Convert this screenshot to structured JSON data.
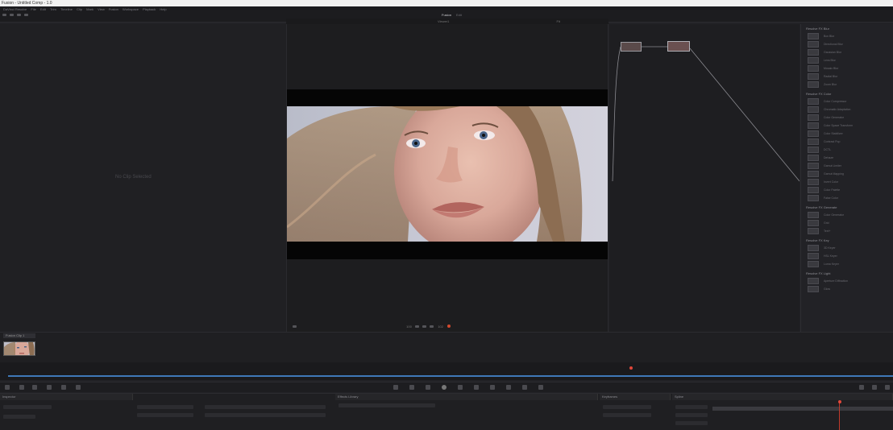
{
  "window": {
    "title": "Fusion - Untitled Comp - 1.0"
  },
  "menu": [
    "DaVinci Resolve",
    "File",
    "Edit",
    "Trim",
    "Timeline",
    "Clip",
    "Mark",
    "View",
    "Fusion",
    "Workspace",
    "Playback",
    "Help"
  ],
  "tabs": {
    "left": "Fusion",
    "center": "Edit"
  },
  "viewer": {
    "header_label": "Viewer1",
    "empty_left_text": "No Clip Selected",
    "zoom": "Fit",
    "timecode": "100",
    "frame": "102"
  },
  "clip": {
    "label": "Fusion Clip 1"
  },
  "effects": {
    "sections": [
      {
        "title": "Resolve FX Blur",
        "items": [
          "Box Blur",
          "Directional Blur",
          "Gaussian Blur",
          "Lens Blur",
          "Mosaic Blur",
          "Radial Blur",
          "Zoom Blur"
        ]
      },
      {
        "title": "Resolve FX Color",
        "items": [
          "Color Compressor",
          "Chromatic Adaptation",
          "Color Generator",
          "Color Space Transform",
          "Color Stabilizer",
          "Contrast Pop",
          "DCTL",
          "Dehaze",
          "Gamut Limiter",
          "Gamut Mapping",
          "Invert Color",
          "Color Palette",
          "False Color"
        ]
      },
      {
        "title": "Resolve FX Generate",
        "items": [
          "Color Generator",
          "Grid",
          "Text+"
        ]
      },
      {
        "title": "Resolve FX Key",
        "items": [
          "3D Keyer",
          "HSL Keyer",
          "Luma Keyer"
        ]
      },
      {
        "title": "Resolve FX Light",
        "items": [
          "Aperture Diffraction",
          "Glow"
        ]
      }
    ]
  },
  "bottom": {
    "inspector_title": "Inspector",
    "effects_title": "Effects Library",
    "keyframes_title": "Keyframes",
    "spline_title": "Spline"
  }
}
